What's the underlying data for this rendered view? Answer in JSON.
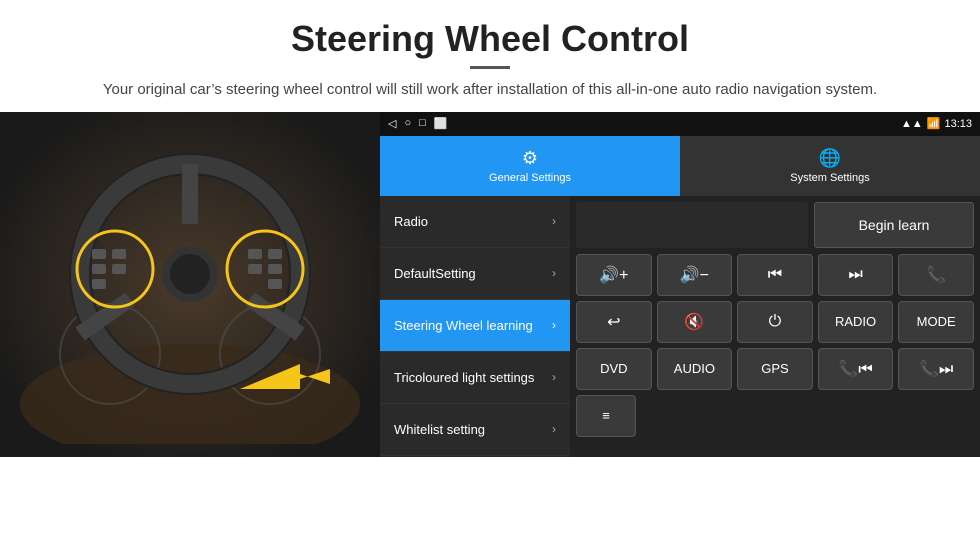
{
  "header": {
    "title": "Steering Wheel Control",
    "divider": true,
    "subtitle": "Your original car’s steering wheel control will still work after installation of this all-in-one auto radio navigation system."
  },
  "status_bar": {
    "nav_icons": [
      "◁",
      "○",
      "□",
      "⬜"
    ],
    "signal_icon": "wifi-signal-icon",
    "time": "13:13"
  },
  "tabs": [
    {
      "id": "general",
      "label": "General Settings",
      "icon": "⚙",
      "active": true
    },
    {
      "id": "system",
      "label": "System Settings",
      "icon": "🌐",
      "active": false
    }
  ],
  "menu_items": [
    {
      "id": "radio",
      "label": "Radio",
      "active": false
    },
    {
      "id": "default_setting",
      "label": "DefaultSetting",
      "active": false
    },
    {
      "id": "steering_wheel",
      "label": "Steering Wheel learning",
      "active": true
    },
    {
      "id": "tricoloured",
      "label": "Tricoloured light settings",
      "active": false
    },
    {
      "id": "whitelist",
      "label": "Whitelist setting",
      "active": false
    }
  ],
  "right_panel": {
    "begin_learn_label": "Begin learn",
    "button_rows": [
      [
        {
          "id": "vol_up",
          "label": "🔊+",
          "type": "icon"
        },
        {
          "id": "vol_down",
          "label": "🔊−",
          "type": "icon"
        },
        {
          "id": "prev_track",
          "label": "⏮",
          "type": "icon"
        },
        {
          "id": "next_track",
          "label": "⏭",
          "type": "icon"
        },
        {
          "id": "phone",
          "label": "📞",
          "type": "icon"
        }
      ],
      [
        {
          "id": "hang_up",
          "label": "↩",
          "type": "icon"
        },
        {
          "id": "mute",
          "label": "🔊✕",
          "type": "icon"
        },
        {
          "id": "power",
          "label": "⏻",
          "type": "icon"
        },
        {
          "id": "radio_btn",
          "label": "RADIO",
          "type": "text"
        },
        {
          "id": "mode_btn",
          "label": "MODE",
          "type": "text"
        }
      ],
      [
        {
          "id": "dvd_btn",
          "label": "DVD",
          "type": "text"
        },
        {
          "id": "audio_btn",
          "label": "AUDIO",
          "type": "text"
        },
        {
          "id": "gps_btn",
          "label": "GPS",
          "type": "text"
        },
        {
          "id": "prev_track2",
          "label": "📞⏮",
          "type": "icon"
        },
        {
          "id": "next_track2",
          "label": "📞⏭",
          "type": "icon"
        }
      ],
      [
        {
          "id": "media_btn",
          "label": "≡",
          "type": "icon"
        }
      ]
    ]
  }
}
